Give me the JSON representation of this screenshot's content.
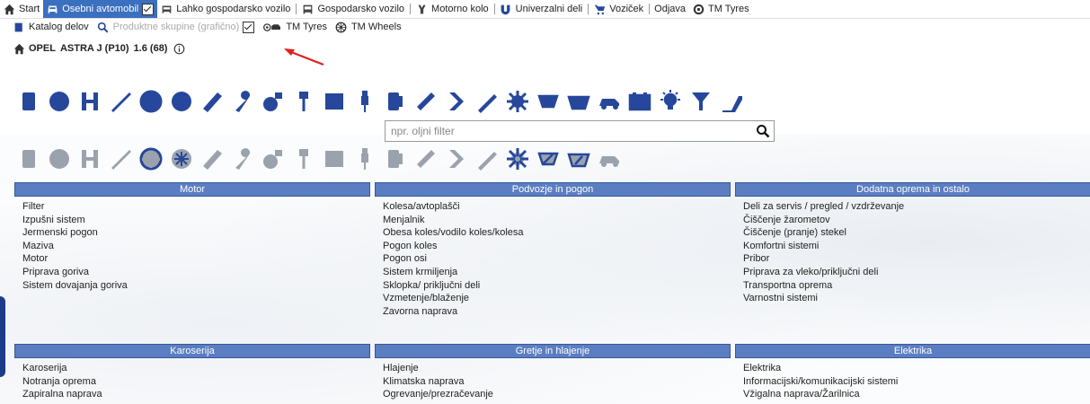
{
  "menu": {
    "items": [
      {
        "label": "Start",
        "icon": "home-icon",
        "active": false
      },
      {
        "label": "Osebni avtomobil",
        "icon": "car-icon",
        "active": true,
        "checkbox": true
      },
      {
        "label": "Lahko gospodarsko vozilo",
        "icon": "van-icon",
        "active": false
      },
      {
        "label": "Gospodarsko vozilo",
        "icon": "truck-icon",
        "active": false
      },
      {
        "label": "Motorno kolo",
        "icon": "motorcycle-icon",
        "active": false
      },
      {
        "label": "Univerzalni deli",
        "icon": "magnet-icon",
        "active": false
      },
      {
        "label": "Voziček",
        "icon": "cart-icon",
        "active": false
      },
      {
        "label": "Odjava",
        "icon": "",
        "active": false
      },
      {
        "label": "TM Tyres",
        "icon": "tyre-icon",
        "active": false
      }
    ]
  },
  "submenu": {
    "catalog": "Katalog delov",
    "product_groups": "Produktne skupine (grafično)",
    "tm_tyres": "TM Tyres",
    "tm_wheels": "TM Wheels"
  },
  "vehicle": {
    "make": "OPEL",
    "model": "ASTRA J (P10)",
    "engine": "1.6 (68)"
  },
  "search": {
    "placeholder": "npr. oljni filter"
  },
  "icon_row_1": [
    "door-icon",
    "pulley-icon",
    "suspension-icon",
    "spark-plug-icon",
    "steering-wheel-icon",
    "wheel-icon",
    "exhaust-icon",
    "wrench-icon",
    "turbo-icon",
    "piston-icon",
    "radiator-icon",
    "injector-icon",
    "fuel-pump-icon",
    "chain-icon",
    "hose-icon",
    "cv-joint-icon",
    "gear-icon",
    "wiper-fan-icon",
    "windscreen-icon",
    "car-electric-icon",
    "battery-icon",
    "bulb-icon",
    "filter-icon",
    "pedal-icon"
  ],
  "icon_row_2": [
    "engine-parts-icon",
    "clutch-icon",
    "brake-parts-icon",
    "car-body-icon",
    "driveshaft-icon",
    "cylinder-icon",
    "intercooler-icon",
    "wiper-icon",
    "towbar-icon",
    "axle-icon",
    "brake-disc-icon",
    "spark-icon",
    "thermometer-icon",
    "steering-icon",
    "seat-icon",
    "lamp-icon",
    "lightning-icon",
    "glow-plug-icon",
    "warning-triangle-icon",
    "tools-icon"
  ],
  "categories": [
    {
      "title": "Motor",
      "items": [
        "Filter",
        "Izpušni sistem",
        "Jermenski pogon",
        "Maziva",
        "Motor",
        "Priprava goriva",
        "Sistem dovajanja goriva"
      ]
    },
    {
      "title": "Podvozje in pogon",
      "items": [
        "Kolesa/avtoplašči",
        "Menjalnik",
        "Obesa koles/vodilo koles/kolesa",
        "Pogon koles",
        "Pogon osi",
        "Sistem krmiljenja",
        "Sklopka/ priključni deli",
        "Vzmetenje/blaženje",
        "Zavorna naprava"
      ]
    },
    {
      "title": "Dodatna oprema in ostalo",
      "items": [
        "Deli za servis / pregled / vzdrževanje",
        "Čiščenje žarometov",
        "Čiščenje (pranje) stekel",
        "Komfortni sistemi",
        "Pribor",
        "Priprava za vleko/priključni deli",
        "Transportna oprema",
        "Varnostni sistemi"
      ]
    },
    {
      "title": "Karoserija",
      "items": [
        "Karoserija",
        "Notranja oprema",
        "Zapiralna naprava"
      ]
    },
    {
      "title": "Gretje in hlajenje",
      "items": [
        "Hlajenje",
        "Klimatska naprava",
        "Ogrevanje/prezračevanje"
      ]
    },
    {
      "title": "Elektrika",
      "items": [
        "Elektrika",
        "Informacijski/komunikacijski sistemi",
        "Vžigalna naprava/Žarilnica"
      ]
    }
  ],
  "colors": {
    "menu_active": "#3b6fbf",
    "header": "#5b7ec2",
    "icon_blue": "#26479b",
    "icon_grey": "#9aa3ad",
    "arrow": "#e02020"
  }
}
